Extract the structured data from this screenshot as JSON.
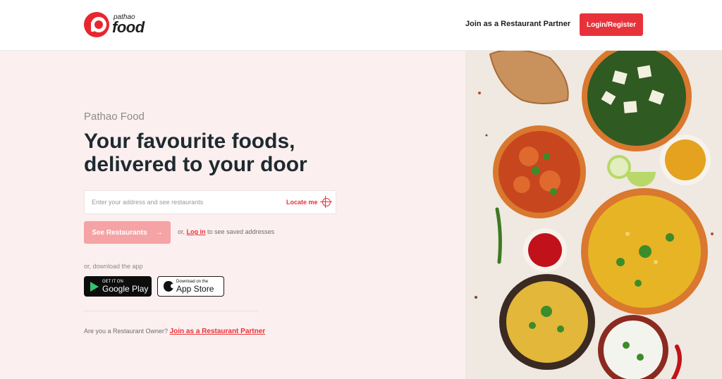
{
  "header": {
    "logo_small": "pathao",
    "logo_big": "food",
    "partner_link": "Join as a Restaurant Partner",
    "login_label": "Login/Register"
  },
  "hero": {
    "brand_label": "Pathao Food",
    "headline_line1": "Your favourite foods,",
    "headline_line2": "delivered to your door",
    "search_placeholder": "Enter your address and see restaurants",
    "locate_label": "Locate me",
    "see_restaurants_label": "See Restaurants",
    "see_restaurants_arrow": "→",
    "or_text": "or,",
    "login_link": "Log in",
    "saved_text": "to see saved addresses",
    "download_label": "or, download the app",
    "google_play_small": "GET IT ON",
    "google_play_big": "Google Play",
    "app_store_small": "Download on the",
    "app_store_big": "App Store",
    "owner_question": "Are you a Restaurant Owner?",
    "owner_link": "Join as a Restaurant Partner"
  },
  "colors": {
    "brand_red": "#e8323a",
    "hero_bg": "#fcefef",
    "disabled_button": "#f5a3a5"
  },
  "icons": [
    "pathao-logo-icon",
    "crosshair-icon",
    "arrow-right-icon",
    "google-play-icon",
    "apple-icon"
  ]
}
